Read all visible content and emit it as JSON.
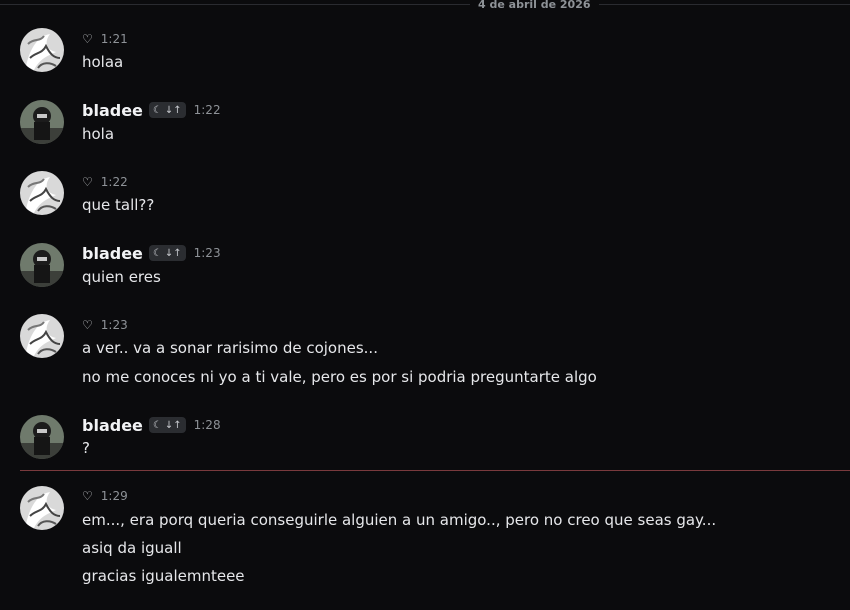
{
  "date_divider": "4 de abril de 2026",
  "messages": [
    {
      "author": "",
      "heart": "♡",
      "time": "1:21",
      "lines": [
        "holaa"
      ]
    },
    {
      "author": "bladee",
      "time": "1:22",
      "lines": [
        "hola"
      ]
    },
    {
      "author": "",
      "heart": "♡",
      "time": "1:22",
      "lines": [
        "que tall??"
      ]
    },
    {
      "author": "bladee",
      "time": "1:23",
      "lines": [
        "quien eres"
      ]
    },
    {
      "author": "",
      "heart": "♡",
      "time": "1:23",
      "lines": [
        "a ver.. va a sonar rarisimo de cojones...",
        "no me conoces ni yo a ti vale, pero es por si podria preguntarte algo"
      ]
    },
    {
      "author": "bladee",
      "time": "1:28",
      "lines": [
        "?"
      ]
    },
    {
      "author": "",
      "heart": "♡",
      "time": "1:29",
      "lines": [
        "em..., era porq queria conseguirle alguien a un amigo.., pero no creo que seas gay...",
        "asiq da iguall",
        "gracias igualemnteee"
      ]
    }
  ],
  "icons": {
    "user_avatar": "white-abstract-avatar",
    "bladee_avatar": "dark-photo-avatar",
    "badge": "crescent-moon-badge",
    "reaction": "heart-icon"
  },
  "colors": {
    "background": "#0b0b0d",
    "new_divider": "#7a3a3d",
    "text": "#dbdee1"
  }
}
